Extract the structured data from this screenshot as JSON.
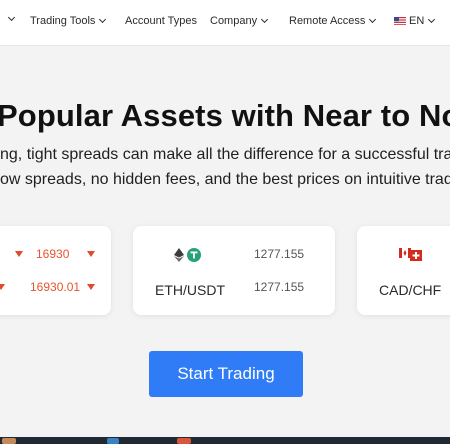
{
  "nav": {
    "items": [
      {
        "label": "Trading Tools"
      },
      {
        "label": "Account Types"
      },
      {
        "label": "Company"
      },
      {
        "label": "Remote Access"
      },
      {
        "label": "EN"
      }
    ]
  },
  "hero": {
    "headline": "Popular Assets with Near to No",
    "sub_line1": "ng, tight spreads can make all the difference for a successful trad",
    "sub_line2": "ow spreads, no hidden fees, and the best prices on intuitive tradin"
  },
  "cards": {
    "left": {
      "price1": "16930",
      "price2": "16930.01"
    },
    "middle": {
      "pair": "ETH/USDT",
      "value1": "1277.155",
      "value2": "1277.155"
    },
    "right": {
      "pair": "CAD/CHF"
    }
  },
  "cta": {
    "label": "Start Trading"
  },
  "colors": {
    "accent": "#2f7cf6",
    "price_red": "#e8542f",
    "headline": "#111111"
  }
}
